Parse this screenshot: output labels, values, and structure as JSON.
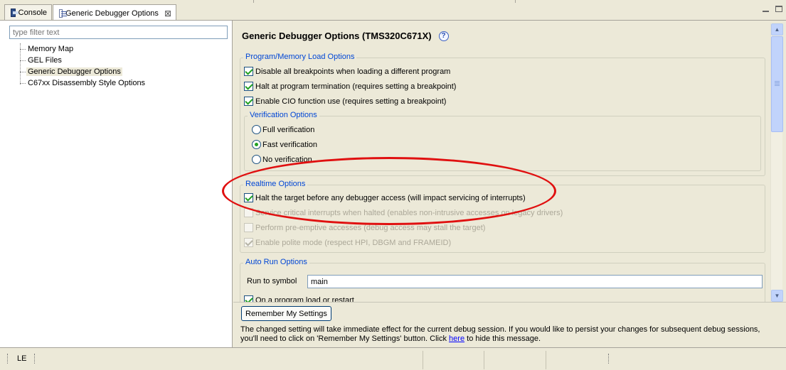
{
  "tabs": [
    {
      "label": "Console",
      "icon": "console-icon"
    },
    {
      "label": "Generic Debugger Options",
      "icon": "options-icon",
      "closeGlyph": "⊠"
    }
  ],
  "filter": {
    "placeholder": "type filter text"
  },
  "tree": {
    "items": [
      "Memory Map",
      "GEL Files",
      "Generic Debugger Options",
      "C67xx Disassembly Style Options"
    ],
    "selected": "Generic Debugger Options"
  },
  "page": {
    "title": "Generic Debugger Options (TMS320C671X)",
    "helpIcon": "?"
  },
  "programLoad": {
    "legend": "Program/Memory Load Options",
    "options": [
      {
        "label": "Disable all breakpoints when loading a different program",
        "checked": true
      },
      {
        "label": "Halt at program termination (requires setting a breakpoint)",
        "checked": true
      },
      {
        "label": "Enable CIO function use (requires setting a breakpoint)",
        "checked": true
      }
    ]
  },
  "verification": {
    "legend": "Verification Options",
    "options": [
      {
        "label": "Full verification",
        "checked": false
      },
      {
        "label": "Fast verification",
        "checked": true
      },
      {
        "label": "No verification",
        "checked": false
      }
    ]
  },
  "realtime": {
    "legend": "Realtime Options",
    "options": [
      {
        "label": "Halt the target before any debugger access (will impact servicing of interrupts)",
        "checked": true,
        "enabled": true
      },
      {
        "label": "Service critical interrupts when halted (enables non-intrusive accesses on legacy drivers)",
        "checked": false,
        "enabled": false
      },
      {
        "label": "Perform pre-emptive accesses (debug access may stall the target)",
        "checked": false,
        "enabled": false
      },
      {
        "label": "Enable polite mode (respect HPI, DBGM and FRAMEID)",
        "checked": true,
        "enabled": false
      }
    ]
  },
  "autoRun": {
    "legend": "Auto Run Options",
    "symbolLabel": "Run to symbol",
    "symbolValue": "main",
    "partialOption": {
      "label": "On a program load or restart",
      "checked": true
    }
  },
  "rememberButton": "Remember My Settings",
  "info": {
    "text": "The changed setting will take immediate effect for the current debug session.  If you would like to persist your changes for subsequent debug sessions, you'll need to click on 'Remember My Settings' button. Click ",
    "link": "here",
    "suffix": " to hide this message."
  },
  "status": {
    "label": "LE"
  },
  "colors": {
    "accent": "#0046d5",
    "highlight": "#e01010",
    "check": "#21a121"
  }
}
